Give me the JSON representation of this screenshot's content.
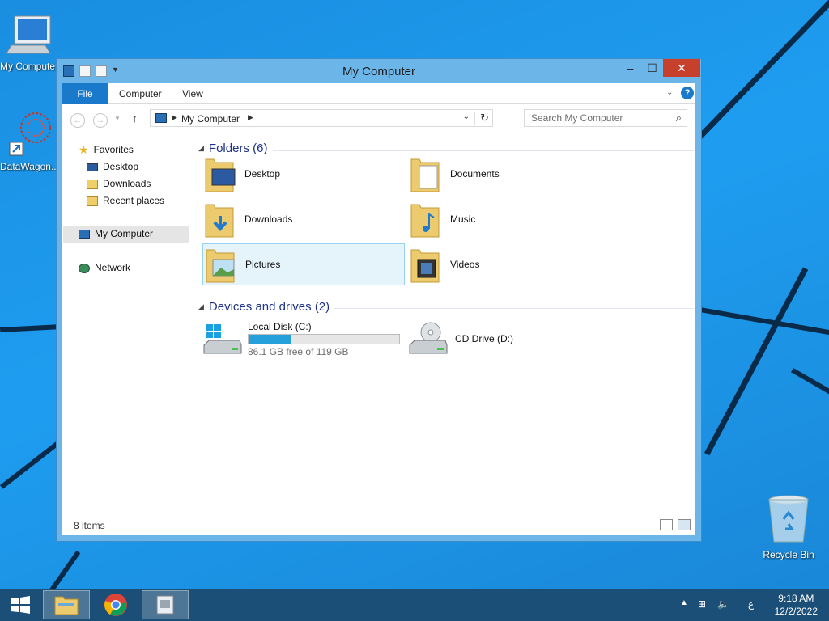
{
  "desktop": {
    "icons": [
      {
        "label": "My Computer"
      },
      {
        "label": "DataWagon..."
      },
      {
        "label": "Recycle Bin"
      }
    ]
  },
  "window": {
    "title": "My Computer",
    "controls": {
      "minimize": "–",
      "maximize": "☐",
      "close": "✕"
    },
    "ribbon": {
      "tabs": [
        "File",
        "Computer",
        "View"
      ]
    },
    "address": {
      "breadcrumb": "My Computer"
    },
    "search": {
      "placeholder": "Search My Computer"
    },
    "nav": {
      "favorites": "Favorites",
      "items": [
        "Desktop",
        "Downloads",
        "Recent places"
      ],
      "my_computer": "My Computer",
      "network": "Network"
    },
    "folders": {
      "header": "Folders (6)",
      "items": [
        "Desktop",
        "Documents",
        "Downloads",
        "Music",
        "Pictures",
        "Videos"
      ]
    },
    "devices": {
      "header": "Devices and drives (2)",
      "local_disk": {
        "name": "Local Disk (C:)",
        "free": "86.1 GB free of 119 GB",
        "used_fraction": 0.28
      },
      "cd_drive": {
        "name": "CD Drive (D:)"
      }
    },
    "status": {
      "count": "8 items"
    }
  },
  "taskbar": {
    "tray_language": "ع",
    "time": "9:18 AM",
    "date": "12/2/2022"
  },
  "colors": {
    "accent": "#1979ca",
    "title_bar": "#6cb5e8",
    "close": "#c7402c",
    "header_text": "#1e3287"
  }
}
